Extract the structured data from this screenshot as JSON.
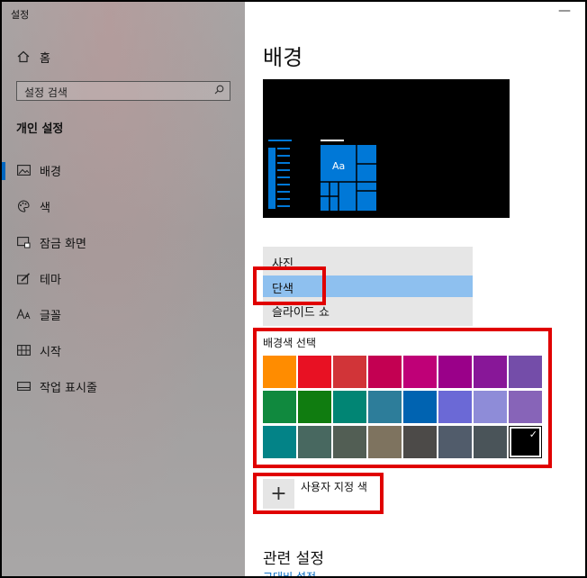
{
  "window": {
    "title": "설정",
    "minimize_glyph": "—"
  },
  "sidebar": {
    "home_label": "홈",
    "search_placeholder": "설정 검색",
    "section_title": "개인 설정",
    "items": [
      {
        "label": "배경",
        "icon": "picture-icon",
        "active": true
      },
      {
        "label": "색",
        "icon": "palette-icon"
      },
      {
        "label": "잠금 화면",
        "icon": "lock-screen-icon"
      },
      {
        "label": "테마",
        "icon": "theme-brush-icon"
      },
      {
        "label": "글꼴",
        "icon": "font-icon"
      },
      {
        "label": "시작",
        "icon": "start-tiles-icon"
      },
      {
        "label": "작업 표시줄",
        "icon": "taskbar-icon"
      }
    ]
  },
  "main": {
    "page_title": "배경",
    "preview_tile_label": "Aa",
    "background_options": [
      "사진",
      "단색",
      "슬라이드 쇼"
    ],
    "selected_background": "단색",
    "color_section_title": "배경색 선택",
    "colors": [
      [
        "#ff8c00",
        "#e81123",
        "#d13438",
        "#c30052",
        "#bf0077",
        "#9a0089",
        "#881798",
        "#744da9"
      ],
      [
        "#10893e",
        "#107c10",
        "#018574",
        "#2d7d9a",
        "#0063b1",
        "#6b69d6",
        "#8e8cd8",
        "#8764b8"
      ],
      [
        "#038387",
        "#486860",
        "#525e54",
        "#7e735f",
        "#4c4a48",
        "#515c6b",
        "#4a5459",
        "#000000"
      ]
    ],
    "selected_color": "#000000",
    "checkmark_glyph": "✓",
    "custom_color_label": "사용자 지정 색",
    "custom_color_plus": "+",
    "related_title": "관련 설정",
    "related_link": "고대비 설정"
  },
  "accent_color": "#0067c0",
  "highlight_color": "#e00000"
}
